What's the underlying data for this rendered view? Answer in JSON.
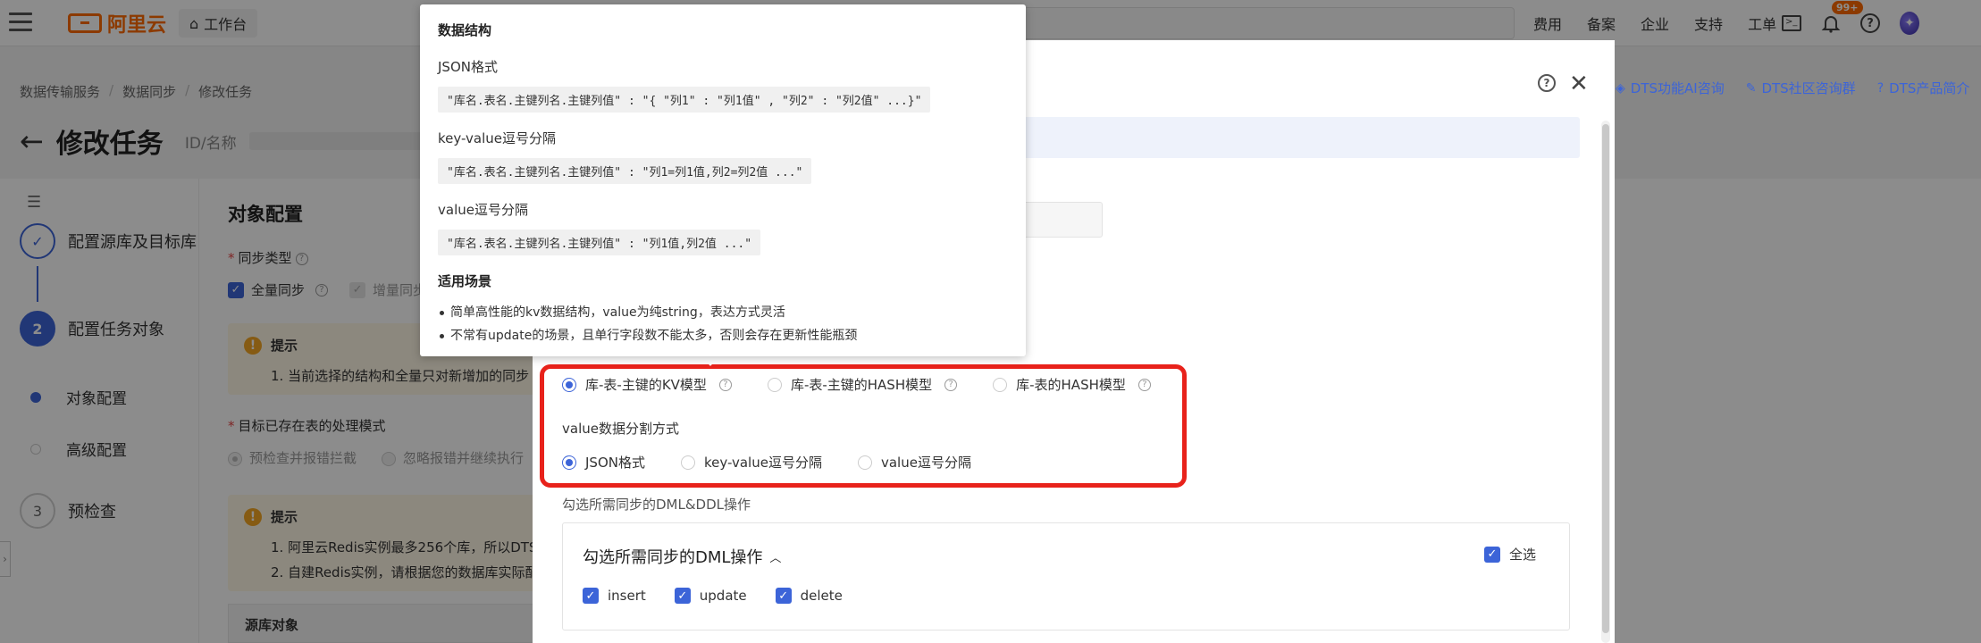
{
  "topbar": {
    "logo_text": "阿里云",
    "workbench_label": "工作台",
    "nav_items": [
      "费用",
      "备案",
      "企业",
      "支持",
      "工单"
    ],
    "badge_count": "99+"
  },
  "breadcrumb": [
    "数据传输服务",
    "数据同步",
    "修改任务"
  ],
  "page": {
    "title": "修改任务",
    "id_label": "ID/名称"
  },
  "steps": [
    {
      "index": "",
      "label": "配置源库及目标库"
    },
    {
      "index": "2",
      "label": "配置任务对象"
    },
    {
      "index": "3",
      "label": "预检查"
    }
  ],
  "substeps": [
    "对象配置",
    "高级配置"
  ],
  "content": {
    "section_title": "对象配置",
    "sync_type_label": "同步类型",
    "full_sync_label": "全量同步",
    "incr_sync_label": "增量同步",
    "tip_title": "提示",
    "tip1_line1": "1. 当前选择的结构和全量只对新增加的同步",
    "existing_table_label": "目标已存在表的处理模式",
    "mode_option1": "预检查并报错拦截",
    "mode_option2": "忽略报错并继续执行",
    "tip2_line1": "1. 阿里云Redis实例最多256个库，所以DTS",
    "tip2_line2": "2. 自建Redis实例，请根据您的数据库实际配",
    "source_object_header": "源库对象"
  },
  "dts_links": [
    "DTS功能AI咨询",
    "DTS社区咨询群",
    "DTS产品简介"
  ],
  "drawer": {
    "model_options": [
      "库-表-主键的KV模型",
      "库-表-主键的HASH模型",
      "库-表的HASH模型"
    ],
    "model_selected": 0,
    "split_label": "value数据分割方式",
    "split_options": [
      "JSON格式",
      "key-value逗号分隔",
      "value逗号分隔"
    ],
    "split_selected": 0,
    "dml_section_label": "勾选所需同步的DML&DDL操作",
    "dml_box_title": "勾选所需同步的DML操作",
    "select_all_label": "全选",
    "dml_ops": [
      "insert",
      "update",
      "delete"
    ]
  },
  "popover": {
    "heading": "数据结构",
    "json_label": "JSON格式",
    "json_code": "\"库名.表名.主键列名.主键列值\" : \"{ \"列1\" : \"列1值\" , \"列2\" : \"列2值\" ...}\"",
    "kv_label": "key-value逗号分隔",
    "kv_code": "\"库名.表名.主键列名.主键列值\" : \"列1=列1值,列2=列2值 ...\"",
    "v_label": "value逗号分隔",
    "v_code": "\"库名.表名.主键列名.主键列值\" : \"列1值,列2值 ...\"",
    "scenario_heading": "适用场景",
    "scenarios": [
      "简单高性能的kv数据结构，value为纯string，表达方式灵活",
      "不常有update的场景，且单行字段数不能太多，否则会存在更新性能瓶颈"
    ]
  },
  "colors": {
    "brand": "#ff6a00",
    "accent": "#3c64d8",
    "highlight_frame": "#e8221b"
  }
}
